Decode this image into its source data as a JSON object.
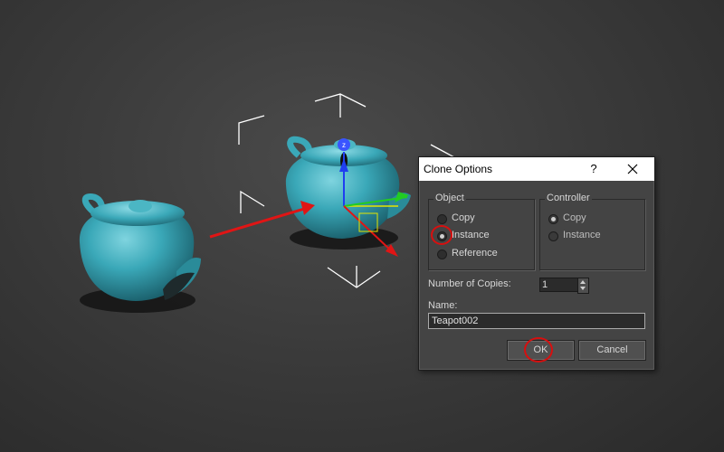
{
  "dialog": {
    "title": "Clone Options",
    "help_label": "?",
    "close_label": "✕",
    "object_group": {
      "label": "Object",
      "options": [
        {
          "label": "Copy",
          "selected": false
        },
        {
          "label": "Instance",
          "selected": true
        },
        {
          "label": "Reference",
          "selected": false
        }
      ]
    },
    "controller_group": {
      "label": "Controller",
      "options": [
        {
          "label": "Copy",
          "selected": true
        },
        {
          "label": "Instance",
          "selected": false
        }
      ]
    },
    "copies": {
      "label": "Number of Copies:",
      "value": "1"
    },
    "name": {
      "label": "Name:",
      "value": "Teapot002"
    },
    "ok_label": "OK",
    "cancel_label": "Cancel"
  },
  "viewport": {
    "object_color": "#3aa8b8",
    "arrow_color": "#e01515",
    "highlight_color": "#d80f0f",
    "gizmo": {
      "z_label": "z"
    }
  }
}
